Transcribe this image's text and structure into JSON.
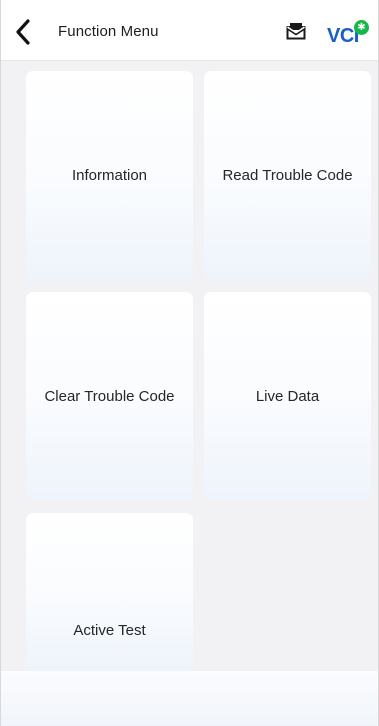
{
  "header": {
    "title": "Function Menu",
    "vci_label": "VCI",
    "vci_status_symbol": "✱",
    "vci_status_color": "#16b84a",
    "icons": [
      "back-icon",
      "mail-icon",
      "vci-bluetooth-icon"
    ]
  },
  "menu": {
    "items": [
      {
        "label": "Information"
      },
      {
        "label": "Read Trouble Code"
      },
      {
        "label": "Clear Trouble Code"
      },
      {
        "label": "Live Data"
      },
      {
        "label": "Active Test"
      }
    ]
  },
  "colors": {
    "accent": "#1a5cc8",
    "background": "#f2f2f4",
    "tile_gradient_end": "#eef4fb"
  }
}
